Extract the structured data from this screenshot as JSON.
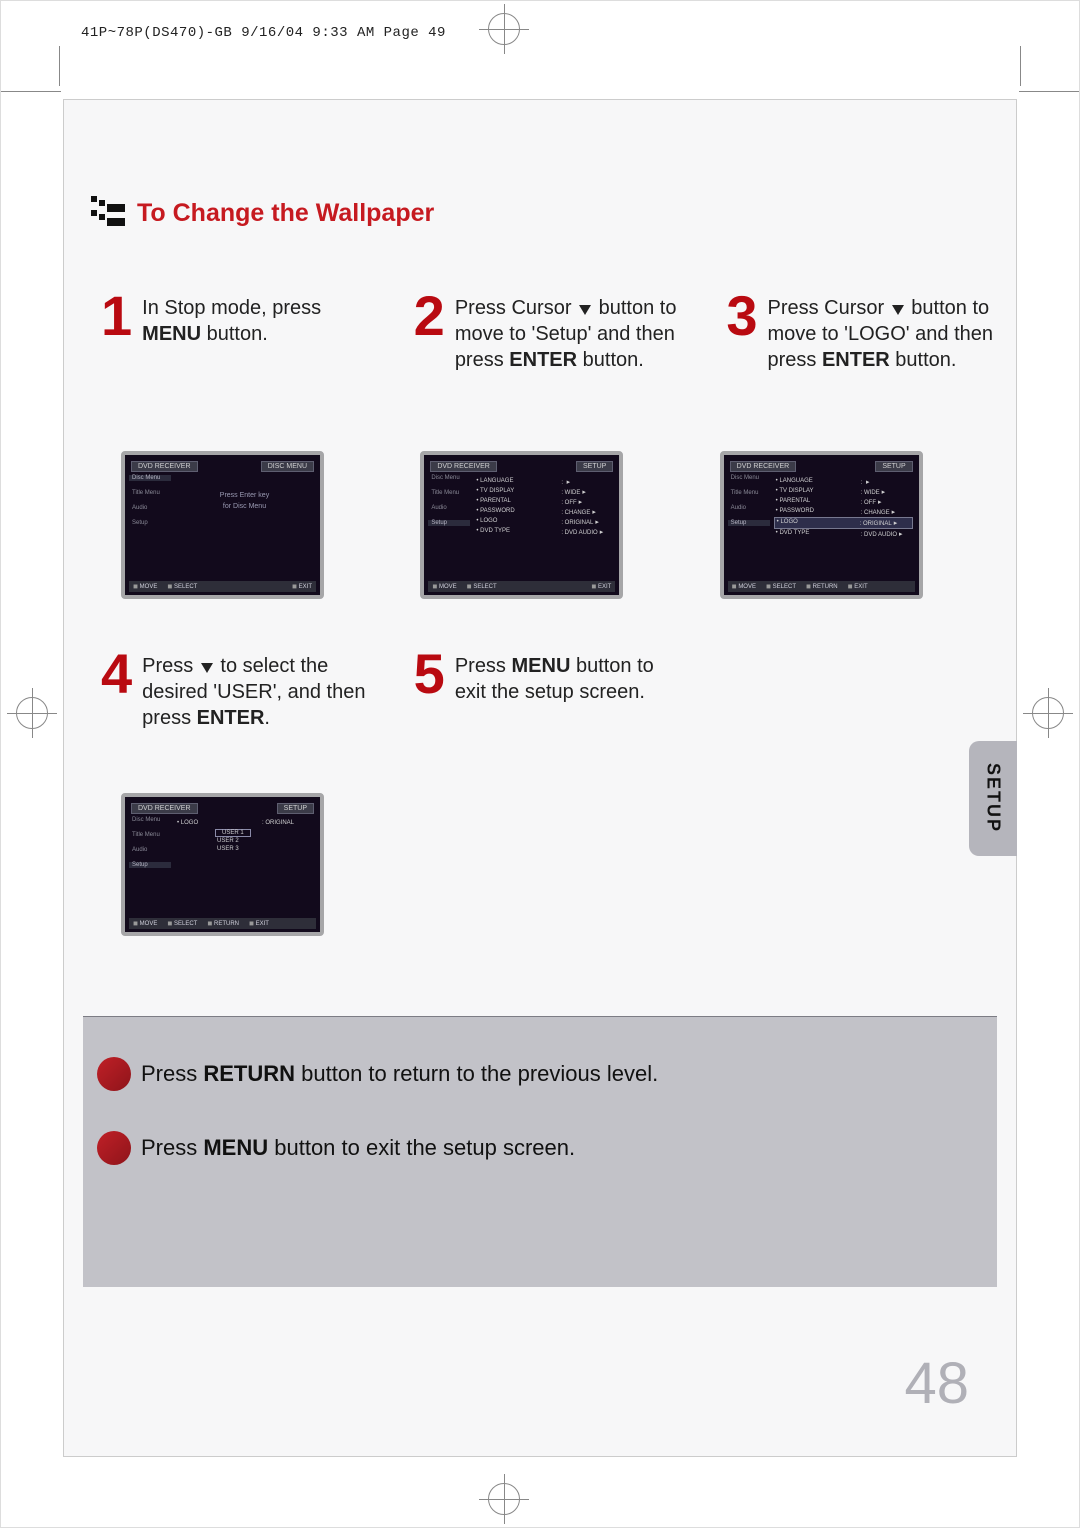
{
  "header": {
    "print_info": "41P~78P(DS470)-GB  9/16/04 9:33 AM  Page 49"
  },
  "title": "To Change the Wallpaper",
  "steps": [
    {
      "num": "1",
      "text_before": "In Stop mode, press ",
      "bold1": "MENU",
      "text_after": " button."
    },
    {
      "num": "2",
      "text_before": "Press Cursor ",
      "text_mid": " button to move to 'Setup' and then press ",
      "bold1": "ENTER",
      "text_after": " button."
    },
    {
      "num": "3",
      "text_before": "Press Cursor ",
      "text_mid": " button to move to 'LOGO' and then press ",
      "bold1": "ENTER",
      "text_after": " button."
    },
    {
      "num": "4",
      "text_before": "Press ",
      "text_mid": " to select the desired 'USER', and then press ",
      "bold1": "ENTER",
      "text_after": "."
    },
    {
      "num": "5",
      "text_before": "Press ",
      "bold1": "MENU",
      "text_mid": " button to exit the setup screen.",
      "text_after": ""
    }
  ],
  "side_tab": "SETUP",
  "osd": {
    "menu_left_label": "DVD RECEIVER",
    "menu_right_label_disc": "DISC MENU",
    "menu_right_label_setup": "SETUP",
    "sidebar": [
      "Disc Menu",
      "Title Menu",
      "Audio",
      "Setup"
    ],
    "step1_center": [
      "Press Enter key",
      "for Disc Menu"
    ],
    "setup_rows": [
      {
        "l": "LANGUAGE",
        "v": ""
      },
      {
        "l": "TV DISPLAY",
        "v": "WIDE"
      },
      {
        "l": "PARENTAL",
        "v": "OFF"
      },
      {
        "l": "PASSWORD",
        "v": "CHANGE"
      },
      {
        "l": "LOGO",
        "v": "ORIGINAL"
      },
      {
        "l": "DVD TYPE",
        "v": "DVD AUDIO"
      }
    ],
    "logo_rows": {
      "label": "LOGO",
      "options": [
        "ORIGINAL",
        "USER 1",
        "USER 2",
        "USER 3"
      ]
    },
    "foot": {
      "move": "MOVE",
      "select": "SELECT",
      "return": "RETURN",
      "exit": "EXIT"
    }
  },
  "notes": [
    {
      "t_before": "Press ",
      "bold": "RETURN",
      "t_after": " button to return to the previous level."
    },
    {
      "t_before": "Press ",
      "bold": "MENU",
      "t_after": " button to exit the setup screen."
    }
  ],
  "page_number": "48"
}
